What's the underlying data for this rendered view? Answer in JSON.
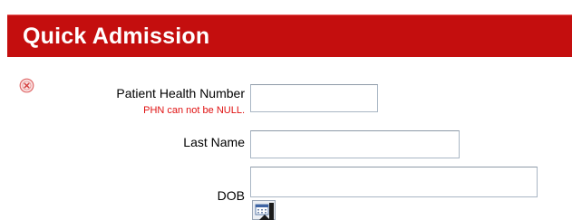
{
  "header": {
    "title": "Quick Admission"
  },
  "form": {
    "phn": {
      "label": "Patient Health Number",
      "value": "",
      "error": "PHN can not be NULL.",
      "error_icon": "error-circle-icon"
    },
    "last_name": {
      "label": "Last Name",
      "value": ""
    },
    "dob": {
      "label": "DOB",
      "value": "",
      "picker_icon": "calendar-icon"
    }
  },
  "colors": {
    "header_bg": "#c40e0e",
    "header_text": "#ffffff",
    "error_text": "#e01212",
    "label_text": "#000000",
    "field_border": "#a9b6c4"
  }
}
